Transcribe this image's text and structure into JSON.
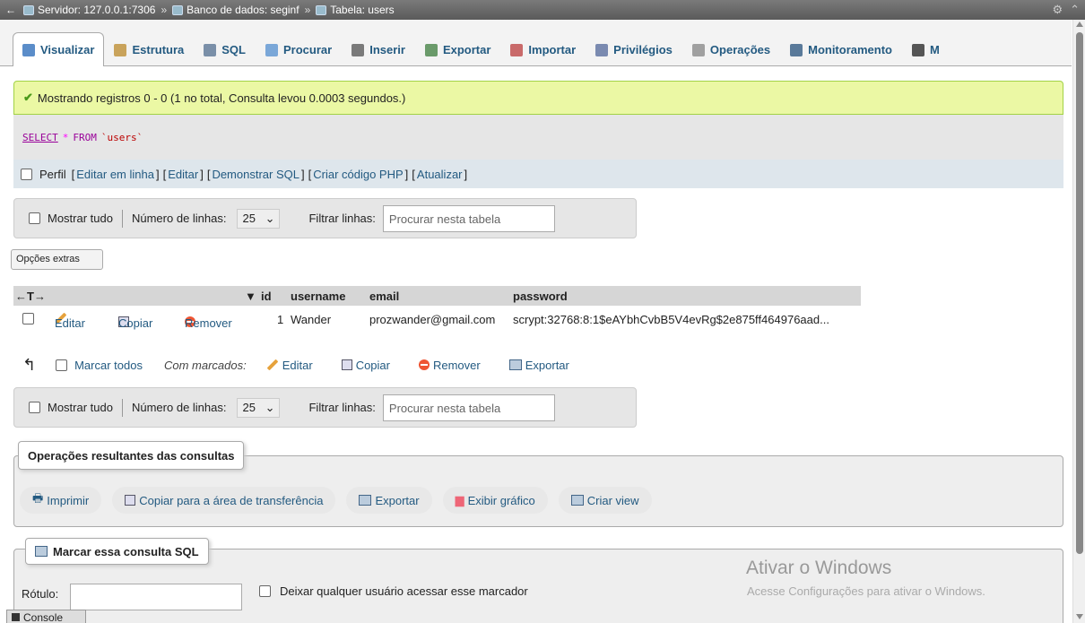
{
  "breadcrumb": {
    "server": "Servidor: 127.0.0.1:7306",
    "database": "Banco de dados: seginf",
    "table": "Tabela: users",
    "separator": "»"
  },
  "tabs": [
    {
      "label": "Visualizar",
      "icon": "browse-icon",
      "active": true
    },
    {
      "label": "Estrutura",
      "icon": "structure-icon",
      "active": false
    },
    {
      "label": "SQL",
      "icon": "sql-icon",
      "active": false
    },
    {
      "label": "Procurar",
      "icon": "search-icon",
      "active": false
    },
    {
      "label": "Inserir",
      "icon": "insert-icon",
      "active": false
    },
    {
      "label": "Exportar",
      "icon": "export-icon",
      "active": false
    },
    {
      "label": "Importar",
      "icon": "import-icon",
      "active": false
    },
    {
      "label": "Privilégios",
      "icon": "privileges-icon",
      "active": false
    },
    {
      "label": "Operações",
      "icon": "operations-icon",
      "active": false
    },
    {
      "label": "Monitoramento",
      "icon": "tracking-icon",
      "active": false
    },
    {
      "label": "M",
      "icon": "more-icon",
      "active": false
    }
  ],
  "message": {
    "text": "Mostrando registros 0 - 0 (1 no total, Consulta levou 0.0003 segundos.)"
  },
  "sql": {
    "select": "SELECT",
    "star": "*",
    "from": "FROM",
    "table": "`users`"
  },
  "tools": {
    "profile": "Perfil",
    "links": [
      "Editar em linha",
      "Editar",
      "Demonstrar SQL",
      "Criar código PHP",
      "Atualizar"
    ]
  },
  "filters": {
    "show_all": "Mostrar tudo",
    "rows_label": "Número de linhas:",
    "rows_value": "25",
    "filter_label": "Filtrar linhas:",
    "filter_placeholder": "Procurar nesta tabela"
  },
  "extras_button": "Opções extras",
  "table": {
    "arrows": "←T→",
    "sort_icon": "▼",
    "columns": [
      "id",
      "username",
      "email",
      "password"
    ],
    "rows": [
      {
        "actions": [
          "Editar",
          "Copiar",
          "Remover"
        ],
        "id": "1",
        "username": "Wander",
        "email": "prozwander@gmail.com",
        "password": "scrypt:32768:8:1$eAYbhCvbB5V4evRg$2e875ff464976aad..."
      }
    ]
  },
  "bulk": {
    "arrow": "↰",
    "select_all": "Marcar todos",
    "with_selected": "Com marcados:",
    "actions": [
      "Editar",
      "Copiar",
      "Remover",
      "Exportar"
    ]
  },
  "query_ops": {
    "title": "Operações resultantes das consultas",
    "buttons": [
      "Imprimir",
      "Copiar para a área de transferência",
      "Exportar",
      "Exibir gráfico",
      "Criar view"
    ]
  },
  "bookmark": {
    "title": "Marcar essa consulta SQL",
    "label": "Rótulo:",
    "share": "Deixar qualquer usuário acessar esse marcador"
  },
  "watermark": {
    "title": "Ativar o Windows",
    "subtitle": "Acesse Configurações para ativar o Windows."
  },
  "console": "Console"
}
